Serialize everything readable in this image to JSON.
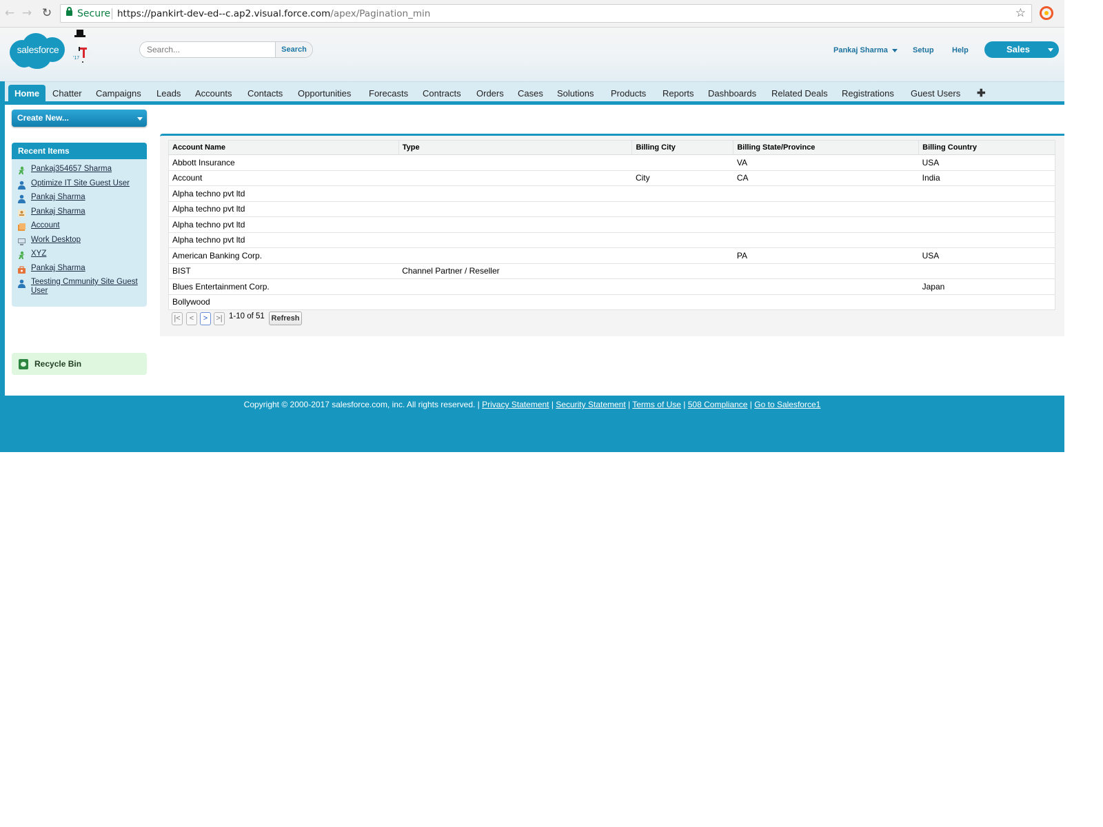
{
  "browser": {
    "secure_label": "Secure",
    "url_host": "https://pankirt-dev-ed--c.ap2.visual.force.com",
    "url_path": "/apex/Pagination_min"
  },
  "header": {
    "logo_text": "salesforce",
    "search": {
      "placeholder": "Search...",
      "button_label": "Search"
    },
    "user_name": "Pankaj Sharma",
    "setup_label": "Setup",
    "help_label": "Help",
    "app_name": "Sales"
  },
  "tabs": [
    "Home",
    "Chatter",
    "Campaigns",
    "Leads",
    "Accounts",
    "Contacts",
    "Opportunities",
    "Forecasts",
    "Contracts",
    "Orders",
    "Cases",
    "Solutions",
    "Products",
    "Reports",
    "Dashboards",
    "Related Deals",
    "Registrations",
    "Guest Users"
  ],
  "tab_add_label": "✚",
  "sidebar": {
    "create_new_label": "Create New...",
    "recent_items_title": "Recent Items",
    "recent_items": [
      {
        "label": "Pankaj354657 Sharma",
        "icon": "person-green-icon"
      },
      {
        "label": "Optimize IT Site Guest User",
        "icon": "user-icon"
      },
      {
        "label": "Pankaj Sharma",
        "icon": "user-icon"
      },
      {
        "label": "Pankaj Sharma",
        "icon": "contact-card-icon"
      },
      {
        "label": "Account",
        "icon": "account-icon"
      },
      {
        "label": "Work Desktop",
        "icon": "desktop-icon"
      },
      {
        "label": "XYZ",
        "icon": "person-green-icon"
      },
      {
        "label": "Pankaj Sharma",
        "icon": "case-icon"
      },
      {
        "label": "Teesting Cmmunity Site Guest User",
        "icon": "user-icon"
      }
    ],
    "recycle_bin_label": "Recycle Bin"
  },
  "table": {
    "columns": [
      "Account Name",
      "Type",
      "Billing City",
      "Billing State/Province",
      "Billing Country"
    ],
    "rows": [
      [
        "Abbott Insurance",
        "",
        "",
        "VA",
        "USA"
      ],
      [
        "Account",
        "",
        "City",
        "CA",
        "India"
      ],
      [
        "Alpha techno pvt ltd",
        "",
        "",
        "",
        ""
      ],
      [
        "Alpha techno pvt ltd",
        "",
        "",
        "",
        ""
      ],
      [
        "Alpha techno pvt ltd",
        "",
        "",
        "",
        ""
      ],
      [
        "Alpha techno pvt ltd",
        "",
        "",
        "",
        ""
      ],
      [
        "American Banking Corp.",
        "",
        "",
        "PA",
        "USA"
      ],
      [
        "BIST",
        "Channel Partner / Reseller",
        "",
        "",
        ""
      ],
      [
        "Blues Entertainment Corp.",
        "",
        "",
        "",
        "Japan"
      ],
      [
        "Bollywood",
        "",
        "",
        "",
        ""
      ]
    ]
  },
  "pager": {
    "first_label": "|<",
    "prev_label": "<",
    "next_label": ">",
    "last_label": ">|",
    "page_info": "1-10 of 51",
    "refresh_label": "Refresh"
  },
  "footer": {
    "copyright": "Copyright © 2000-2017 salesforce.com, inc. All rights reserved. |",
    "links": [
      "Privacy Statement",
      "Security Statement",
      "Terms of Use",
      "508 Compliance",
      "Go to Salesforce1"
    ]
  },
  "colors": {
    "brand": "#1797c0",
    "tab_bar": "#d9ebf3",
    "recent_items_bg": "#d4ebf3",
    "recycle_bin_bg": "#dff6df"
  }
}
